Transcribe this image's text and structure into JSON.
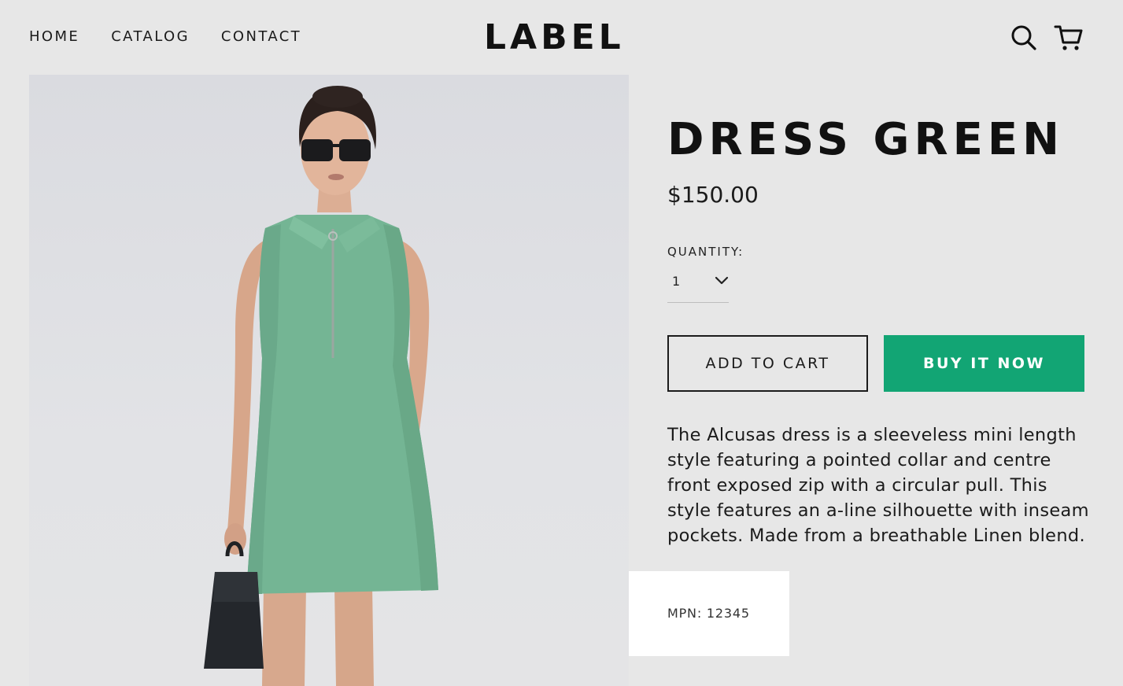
{
  "nav": {
    "items": [
      {
        "label": "HOME"
      },
      {
        "label": "CATALOG"
      },
      {
        "label": "CONTACT"
      }
    ]
  },
  "brand": {
    "logo": "LABEL"
  },
  "icons": {
    "search": "search-icon",
    "cart": "cart-icon"
  },
  "product": {
    "title": "DRESS GREEN",
    "price": "$150.00",
    "quantity_label": "QUANTITY:",
    "quantity_value": "1",
    "add_to_cart_label": "ADD TO CART",
    "buy_now_label": "BUY IT NOW",
    "description": "The Alcusas dress is a sleeveless mini length style featuring a pointed collar and centre front exposed zip with a circular pull. This style features an a-line silhouette with inseam pockets. Made from a breathable Linen blend.",
    "mpn": "MPN: 12345"
  },
  "colors": {
    "background": "#e7e7e7",
    "accent": "#12a574",
    "text": "#1b1b1b",
    "dress": "#74b594"
  }
}
